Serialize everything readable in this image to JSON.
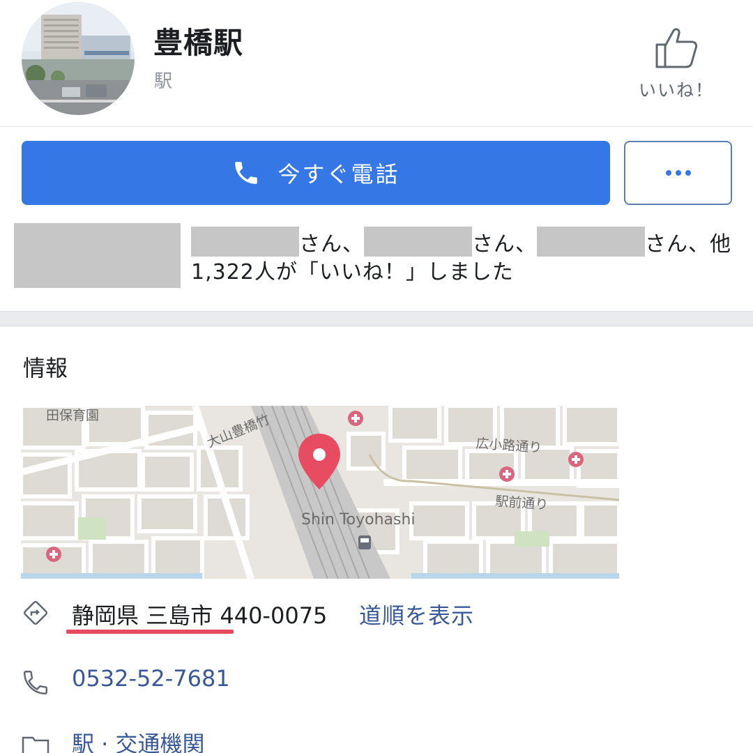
{
  "header": {
    "page_name": "豊橋駅",
    "category": "駅",
    "like_label": "いいね！"
  },
  "actions": {
    "call_label": "今すぐ電話",
    "more_label": "…"
  },
  "friends": {
    "suffix_1": "さん、",
    "suffix_2": "さん、",
    "suffix_3": "さん、他1,322人が「いいね！」しました"
  },
  "info": {
    "section_title": "情報",
    "map": {
      "station_label": "Shin Toyohashi",
      "labels": [
        "田保育園",
        "大山豊橋竹",
        "広小路通り",
        "駅前通り"
      ]
    },
    "address": "静岡県 三島市 440-0075",
    "directions_label": "道順を表示",
    "phone": "0532-52-7681",
    "category": "駅 · 交通機関"
  },
  "colors": {
    "primary_button": "#3578e5",
    "link": "#385898",
    "map_pin": "#e84c63",
    "underline": "#e84a5f"
  },
  "icons": [
    "thumbs-up-icon",
    "phone-icon",
    "more-dots-icon",
    "directions-icon",
    "phone-outline-icon",
    "folder-icon",
    "map-pin-icon",
    "hospital-icon",
    "train-icon"
  ]
}
